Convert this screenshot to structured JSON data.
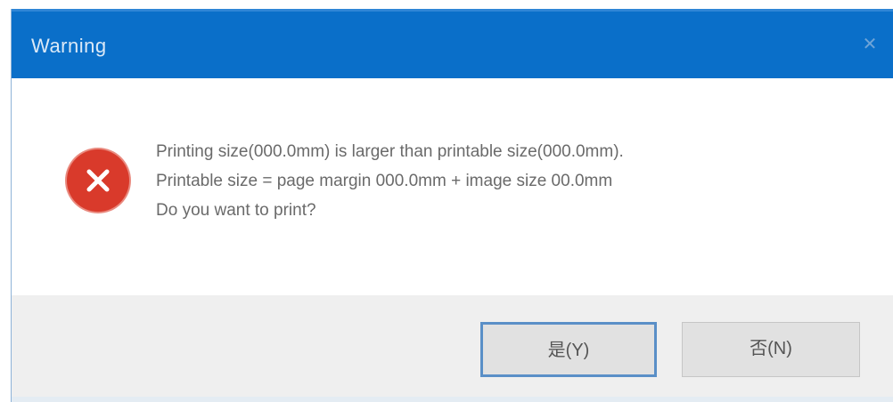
{
  "dialog": {
    "title": "Warning",
    "close_symbol": "✕",
    "icon": "error-icon",
    "message_lines": [
      "Printing size(000.0mm) is larger than printable size(000.0mm).",
      "Printable size = page margin 000.0mm + image size 00.0mm",
      "Do you want to print?"
    ],
    "buttons": {
      "yes_label": "是(Y)",
      "no_label": "否(N)"
    }
  },
  "colors": {
    "titlebar": "#0a6fc9",
    "error_icon": "#d93a2b",
    "footer": "#efefef",
    "focus_border": "#5a8fc7"
  }
}
